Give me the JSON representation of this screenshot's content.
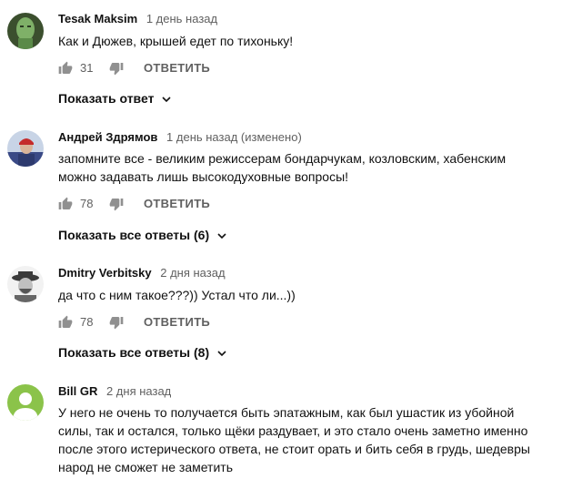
{
  "comments": [
    {
      "author": "Tesak Maksim",
      "time": "1 день назад",
      "text": "Как и Дюжев, крышей едет по тихоньку!",
      "likes": "31",
      "reply_label": "ОТВЕТИТЬ",
      "show_replies": "Показать ответ",
      "avatar_color": "#4a6b3a"
    },
    {
      "author": "Андрей Здрямов",
      "time": "1 день назад (изменено)",
      "text": "запомните все - великим режиссерам бондарчукам, козловским, хабенским можно задавать лишь высокодуховные вопросы!",
      "likes": "78",
      "reply_label": "ОТВЕТИТЬ",
      "show_replies": "Показать все ответы (6)",
      "avatar_color": "#6d7b94"
    },
    {
      "author": "Dmitry Verbitsky",
      "time": "2 дня назад",
      "text": "да что с ним такое???)) Устал что ли...))",
      "likes": "78",
      "reply_label": "ОТВЕТИТЬ",
      "show_replies": "Показать все ответы (8)",
      "avatar_color": "#d9d9d9"
    },
    {
      "author": "Bill GR",
      "time": "2 дня назад",
      "text": "У него не очень то получается быть эпатажным, как был ушастик из убойной силы, так и остался, только щёки раздувает, и это стало очень заметно именно после этого истерического ответа, не стоит орать и бить себя в грудь, шедевры народ не сможет не заметить",
      "avatar_color": "#8bc34a"
    }
  ]
}
